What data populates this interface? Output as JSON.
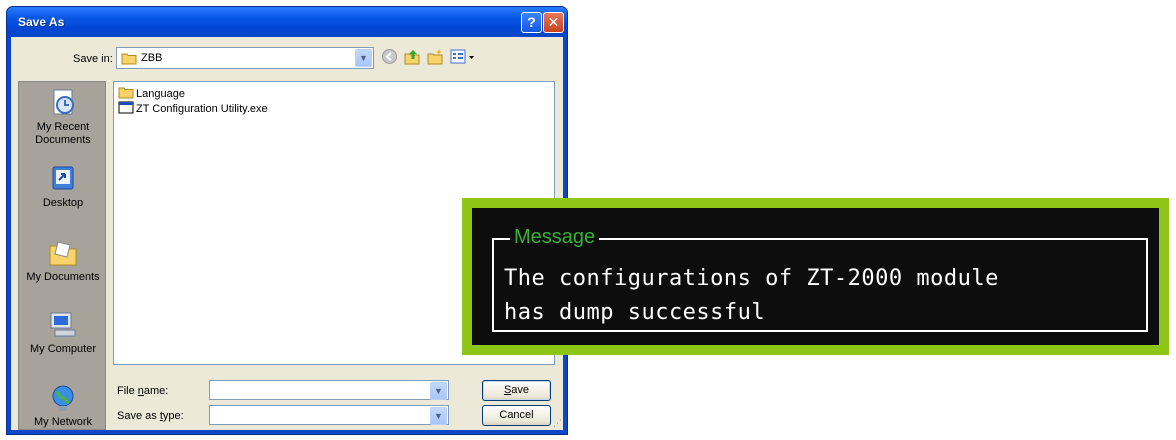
{
  "dialog": {
    "title": "Save As",
    "title_buttons": {
      "help": "?",
      "close": "✕"
    },
    "save_in": {
      "label": "Save in:",
      "value": "ZBB"
    },
    "toolbar_icons": [
      "back-icon",
      "up-folder-icon",
      "new-folder-icon",
      "view-menu-icon"
    ],
    "places": [
      {
        "label": "My Recent Documents",
        "icon": "recent-documents-icon"
      },
      {
        "label": "Desktop",
        "icon": "desktop-icon"
      },
      {
        "label": "My Documents",
        "icon": "my-documents-icon"
      },
      {
        "label": "My Computer",
        "icon": "my-computer-icon"
      },
      {
        "label": "My Network",
        "icon": "my-network-icon"
      }
    ],
    "files": [
      {
        "name": "Language",
        "icon": "folder-icon"
      },
      {
        "name": "ZT Configuration Utility.exe",
        "icon": "exe-file-icon"
      }
    ],
    "file_name": {
      "label": "File name:",
      "value": ""
    },
    "save_as_type": {
      "label": "Save as type:",
      "value": ""
    },
    "buttons": {
      "save": "Save",
      "cancel": "Cancel"
    }
  },
  "message": {
    "legend": "Message",
    "lines": [
      "The configurations of ZT-2000 module",
      "has dump successful"
    ],
    "colors": {
      "border": "#8ec617",
      "legend": "#32b232",
      "background": "#0d0d0d",
      "text": "#ffffff"
    }
  }
}
